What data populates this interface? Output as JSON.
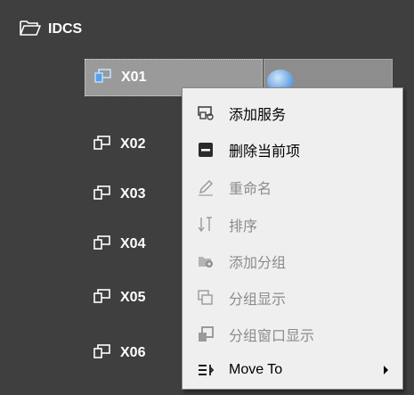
{
  "tree": {
    "root": {
      "label": "IDCS",
      "icon": "folder-open-icon"
    },
    "items": [
      {
        "label": "X01",
        "icon": "server-node-icon",
        "selected": true
      },
      {
        "label": "X02",
        "icon": "server-node-icon"
      },
      {
        "label": "X03",
        "icon": "server-node-icon"
      },
      {
        "label": "X04",
        "icon": "server-node-icon"
      },
      {
        "label": "X05",
        "icon": "server-node-icon"
      },
      {
        "label": "X06",
        "icon": "server-node-icon"
      }
    ]
  },
  "context_menu": {
    "items": [
      {
        "label": "添加服务",
        "icon": "add-service-icon",
        "enabled": true
      },
      {
        "label": "删除当前项",
        "icon": "remove-icon",
        "enabled": true
      },
      {
        "label": "重命名",
        "icon": "pencil-icon",
        "enabled": false
      },
      {
        "label": "排序",
        "icon": "sort-icon",
        "enabled": false
      },
      {
        "label": "添加分组",
        "icon": "add-group-icon",
        "enabled": false
      },
      {
        "label": "分组显示",
        "icon": "group-view-icon",
        "enabled": false
      },
      {
        "label": "分组窗口显示",
        "icon": "group-window-icon",
        "enabled": false
      },
      {
        "label": "Move To",
        "icon": "move-to-icon",
        "enabled": true,
        "submenu": true
      }
    ]
  },
  "colors": {
    "background": "#3f3f3f",
    "selection": "#9a9a9a",
    "menu_bg": "#efefef",
    "disabled_text": "#8c8c8c"
  }
}
